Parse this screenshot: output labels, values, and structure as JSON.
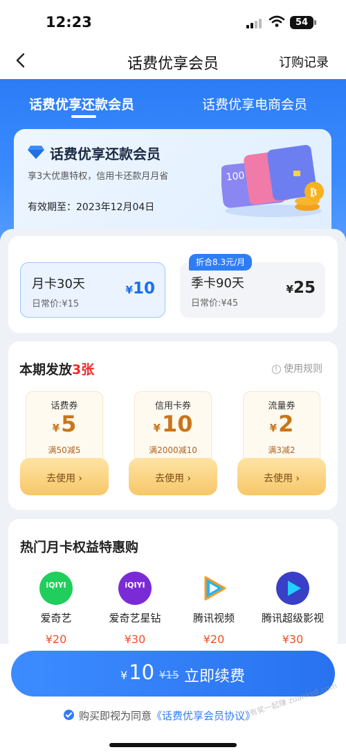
{
  "status": {
    "time": "12:23",
    "battery": "54"
  },
  "nav": {
    "title": "话费优享会员",
    "right": "订购记录",
    "back_icon": "chevron-left-icon"
  },
  "tabs": [
    {
      "label": "话费优享还款会员",
      "active": true
    },
    {
      "label": "话费优享电商会员",
      "active": false
    }
  ],
  "member": {
    "title": "话费优享还款会员",
    "subtitle": "享3大优惠特权，信用卡还款月月省",
    "valid": "有效期至：2023年12月04日"
  },
  "plans": [
    {
      "name": "月卡30天",
      "orig": "日常价:¥15",
      "price": "10",
      "selected": true
    },
    {
      "name": "季卡90天",
      "orig": "日常价:¥45",
      "price": "25",
      "badge": "折合8.3元/月",
      "selected": false
    }
  ],
  "coupons": {
    "title_prefix": "本期发放",
    "title_count": "3张",
    "rule": "使用规则",
    "items": [
      {
        "name": "话费券",
        "amount": "5",
        "cond": "满50减5",
        "button": "去使用"
      },
      {
        "name": "信用卡券",
        "amount": "10",
        "cond": "满2000减10",
        "button": "去使用"
      },
      {
        "name": "流量券",
        "amount": "2",
        "cond": "满3减2",
        "button": "去使用"
      }
    ]
  },
  "hot": {
    "title": "热门月卡权益特惠购",
    "items": [
      {
        "name": "爱奇艺",
        "price": "¥20",
        "icon": "iqiyi-icon",
        "logo_text": "iQIYI"
      },
      {
        "name": "爱奇艺星钻",
        "price": "¥30",
        "icon": "iqiyi-diamond-icon",
        "logo_text": "iQIYI"
      },
      {
        "name": "腾讯视频",
        "price": "¥20",
        "icon": "tencent-video-icon"
      },
      {
        "name": "腾讯超级影视",
        "price": "¥30",
        "icon": "tencent-super-video-icon"
      }
    ]
  },
  "renew": {
    "currency": "¥",
    "price": "10",
    "orig": "¥15",
    "label": "立即续费"
  },
  "agreement": {
    "prefix": "购买即视为同意",
    "link": "《话费优享会员协议》"
  },
  "watermark": "有奖一起赚 zuanke8.com",
  "colors": {
    "primary": "#2f7df6",
    "price_red": "#f05020",
    "coupon_gold": "#c9761b"
  }
}
